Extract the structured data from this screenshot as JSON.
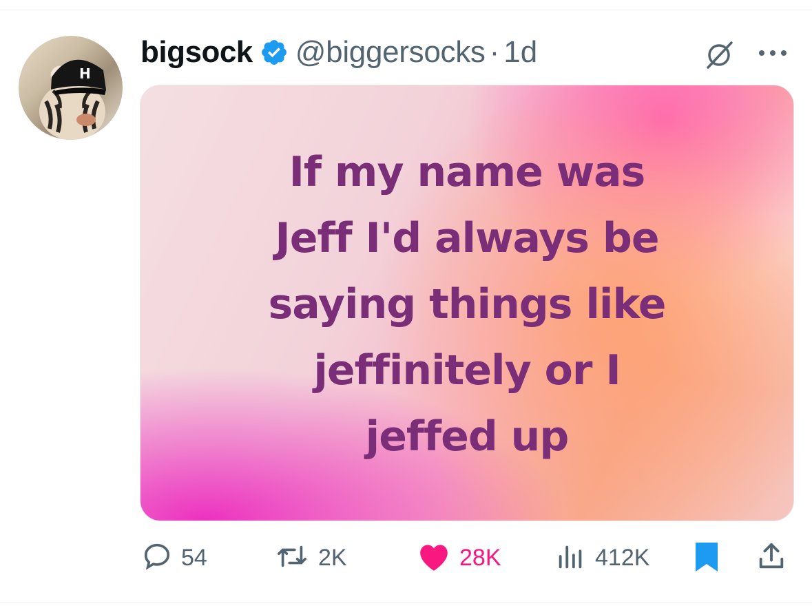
{
  "tweet": {
    "display_name": "bigsock",
    "handle": "@biggersocks",
    "separator": "·",
    "time": "1d",
    "media_text": "If my name was\nJeff I'd always be\nsaying things like\njeffinitely or I\njeffed up"
  },
  "actions": {
    "replies": "54",
    "reposts": "2K",
    "likes": "28K",
    "views": "412K"
  },
  "colors": {
    "verified": "#1d9bf0",
    "like": "#f91880",
    "bookmark": "#1d9bf0",
    "secondary_text": "#536471"
  },
  "icons": [
    "verified-badge-icon",
    "grok-icon",
    "more-icon",
    "reply-icon",
    "repost-icon",
    "like-icon",
    "views-icon",
    "bookmark-icon",
    "share-icon"
  ]
}
